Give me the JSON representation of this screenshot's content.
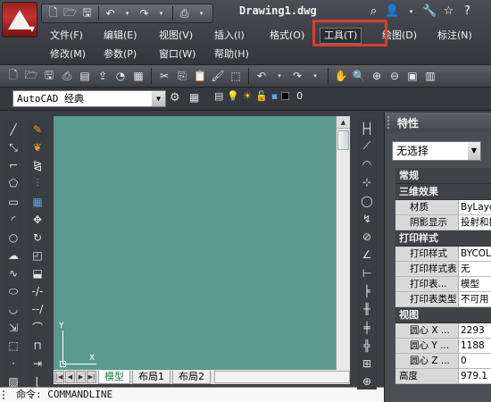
{
  "window": {
    "title": "Drawing1.dwg"
  },
  "menu": [
    {
      "label": "文件(F)"
    },
    {
      "label": "编辑(E)"
    },
    {
      "label": "视图(V)"
    },
    {
      "label": "插入(I)"
    },
    {
      "label": "格式(O)"
    },
    {
      "label": "工具(T)"
    },
    {
      "label": "绘图(D)"
    },
    {
      "label": "标注(N)"
    },
    {
      "label": "修改(M)"
    },
    {
      "label": "参数(P)"
    },
    {
      "label": "窗口(W)"
    },
    {
      "label": "帮助(H)"
    }
  ],
  "workspace": {
    "value": "AutoCAD 经典"
  },
  "layer": {
    "value": "0"
  },
  "tabs": [
    {
      "label": "模型"
    },
    {
      "label": "布局1"
    },
    {
      "label": "布局2"
    }
  ],
  "ucs": {
    "x": "X",
    "y": "Y"
  },
  "command": {
    "text": "命令: COMMANDLINE"
  },
  "properties": {
    "title": "特性",
    "selection": "无选择",
    "sections": [
      {
        "title": "常规",
        "rows": []
      },
      {
        "title": "三维效果",
        "rows": [
          {
            "name": "材质",
            "value": "ByLayer"
          },
          {
            "name": "阴影显示",
            "value": "投射和接收"
          }
        ]
      },
      {
        "title": "打印样式",
        "rows": [
          {
            "name": "打印样式",
            "value": "BYCOLOR"
          },
          {
            "name": "打印样式表",
            "value": "无"
          },
          {
            "name": "打印表...",
            "value": "模型"
          },
          {
            "name": "打印表类型",
            "value": "不可用"
          }
        ]
      },
      {
        "title": "视图",
        "rows": [
          {
            "name": "圆心 X ...",
            "value": "2293"
          },
          {
            "name": "圆心 Y ...",
            "value": "1188"
          },
          {
            "name": "圆心 Z ...",
            "value": "0"
          },
          {
            "name": "高度",
            "value": "979.1"
          }
        ]
      }
    ]
  }
}
